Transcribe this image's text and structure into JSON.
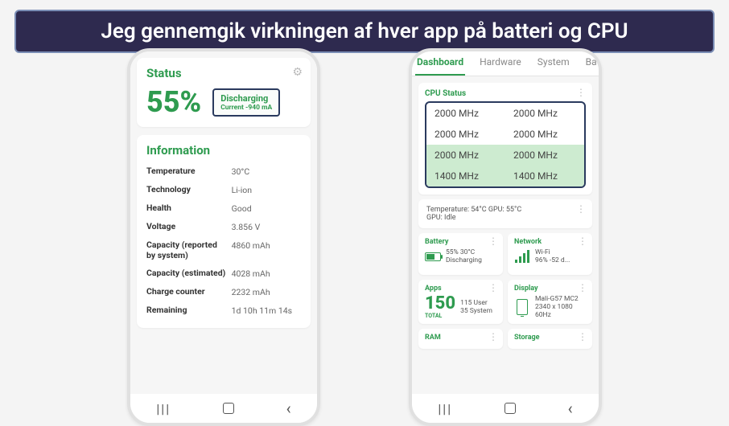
{
  "caption": "Jeg gennemgik virkningen af hver app på batteri og CPU",
  "phone1": {
    "status": {
      "title": "Status",
      "percent": "55%",
      "discharge_label": "Discharging",
      "discharge_current": "Current -940 mA"
    },
    "info": {
      "title": "Information",
      "rows": [
        {
          "k": "Temperature",
          "v": "30°C"
        },
        {
          "k": "Technology",
          "v": "Li-ion"
        },
        {
          "k": "Health",
          "v": "Good"
        },
        {
          "k": "Voltage",
          "v": "3.856 V"
        },
        {
          "k": "Capacity (reported by system)",
          "v": "4860 mAh"
        },
        {
          "k": "Capacity (estimated)",
          "v": "4028 mAh"
        },
        {
          "k": "Charge counter",
          "v": "2232 mAh"
        },
        {
          "k": "Remaining",
          "v": "1d 10h 11m 14s"
        }
      ]
    }
  },
  "phone2": {
    "tabs": [
      "Dashboard",
      "Hardware",
      "System",
      "Battery"
    ],
    "activeTab": 0,
    "cpu": {
      "title": "CPU Status",
      "rows": [
        [
          "2000 MHz",
          "2000 MHz"
        ],
        [
          "2000 MHz",
          "2000 MHz"
        ],
        [
          "2000 MHz",
          "2000 MHz"
        ],
        [
          "1400 MHz",
          "1400 MHz"
        ]
      ]
    },
    "gpu": {
      "line1": "Temperature: 54°C   GPU: 55°C",
      "line2": "GPU: Idle"
    },
    "battery_tile": {
      "title": "Battery",
      "line1": "55%   30°C",
      "line2": "Discharging"
    },
    "network_tile": {
      "title": "Network",
      "line1": "Wi-Fi",
      "line2": "96%   -52 d..."
    },
    "apps_tile": {
      "title": "Apps",
      "count": "150",
      "count_label": "TOTAL",
      "line1": "115 User",
      "line2": "35 System"
    },
    "display_tile": {
      "title": "Display",
      "line1": "Mali-G57 MC2",
      "line2": "2340 x 1080",
      "line3": "60Hz"
    },
    "ram_tile": {
      "title": "RAM"
    },
    "storage_tile": {
      "title": "Storage"
    }
  },
  "nav": {
    "recents": "|||",
    "home": "◯",
    "back": "‹"
  }
}
